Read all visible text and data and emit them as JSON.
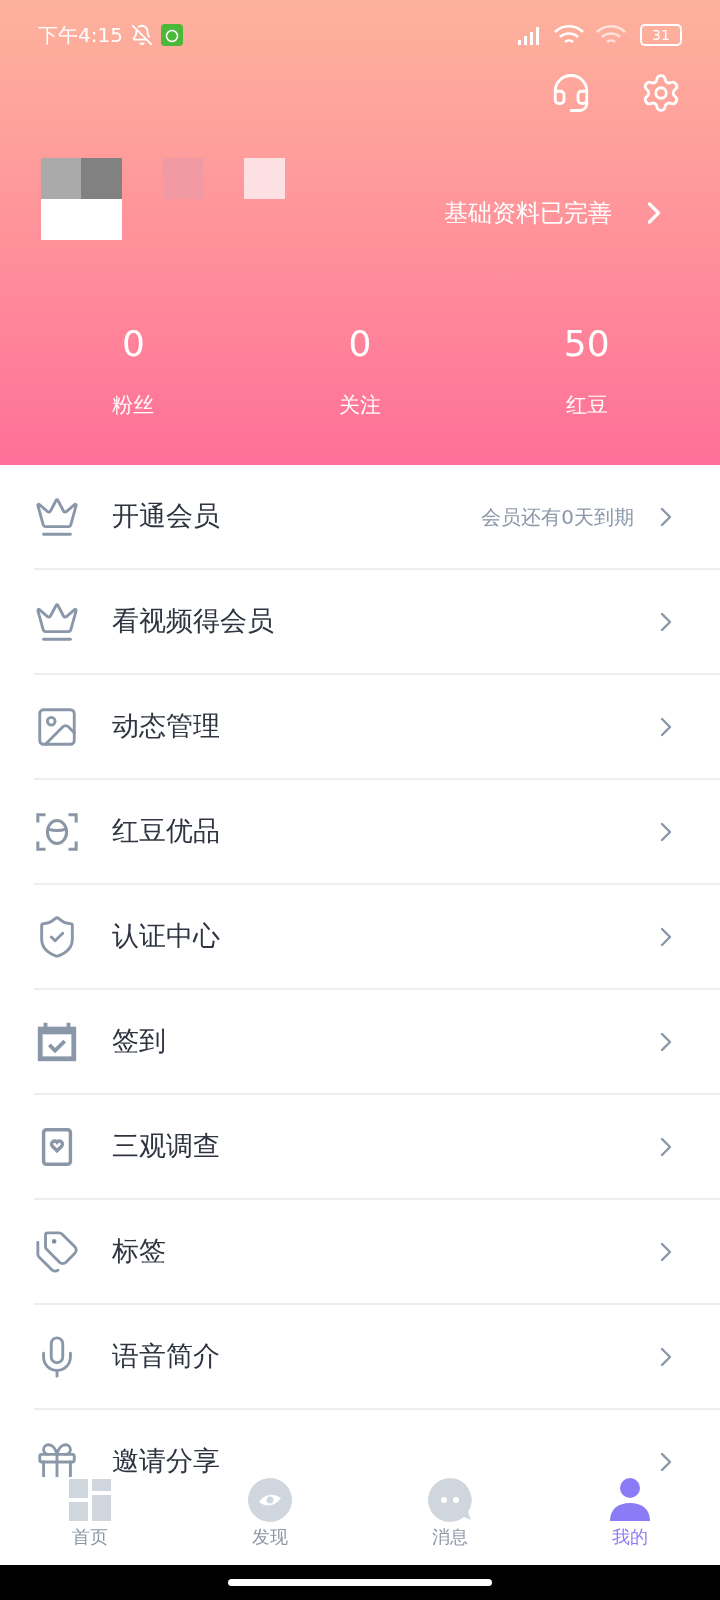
{
  "status_bar": {
    "time": "下午4:15",
    "battery": "31"
  },
  "profile": {
    "info_link": "基础资料已完善"
  },
  "stats": [
    {
      "value": "0",
      "label": "粉丝"
    },
    {
      "value": "0",
      "label": "关注"
    },
    {
      "value": "50",
      "label": "红豆"
    }
  ],
  "menu": [
    {
      "label": "开通会员",
      "note": "会员还有0天到期"
    },
    {
      "label": "看视频得会员"
    },
    {
      "label": "动态管理"
    },
    {
      "label": "红豆优品"
    },
    {
      "label": "认证中心"
    },
    {
      "label": "签到"
    },
    {
      "label": "三观调查"
    },
    {
      "label": "标签"
    },
    {
      "label": "语音简介"
    },
    {
      "label": "邀请分享"
    }
  ],
  "bottom_nav": [
    {
      "label": "首页",
      "selected": false
    },
    {
      "label": "发现",
      "selected": false
    },
    {
      "label": "消息",
      "selected": false
    },
    {
      "label": "我的",
      "selected": true
    }
  ]
}
